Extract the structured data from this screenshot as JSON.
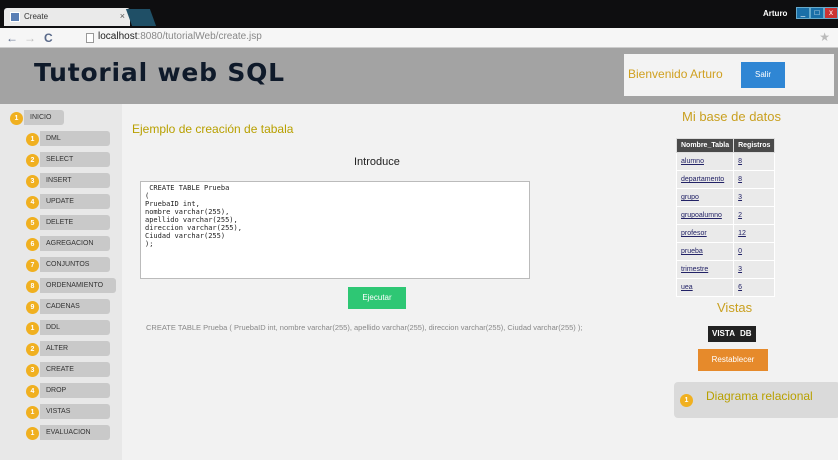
{
  "browser": {
    "tab_title": "Create",
    "tab_close": "×",
    "user": "Arturo",
    "url_host": "localhost",
    "url_rest": ":8080/tutorialWeb/create.jsp",
    "back": "←",
    "forward": "→",
    "reload": "C",
    "star": "★",
    "win_min": "_",
    "win_max": "□",
    "win_close": "x"
  },
  "header": {
    "logo": "Tutorial web SQL",
    "welcome": "Bienvenido Arturo",
    "logout": "Salir"
  },
  "sidebar": {
    "items": [
      {
        "num": "1",
        "label": "INICIO"
      },
      {
        "num": "1",
        "label": "DML"
      },
      {
        "num": "2",
        "label": "SELECT"
      },
      {
        "num": "3",
        "label": "INSERT"
      },
      {
        "num": "4",
        "label": "UPDATE"
      },
      {
        "num": "5",
        "label": "DELETE"
      },
      {
        "num": "6",
        "label": "AGREGACION"
      },
      {
        "num": "7",
        "label": "CONJUNTOS"
      },
      {
        "num": "8",
        "label": "ORDENAMIENTO"
      },
      {
        "num": "9",
        "label": "CADENAS"
      },
      {
        "num": "1",
        "label": "DDL"
      },
      {
        "num": "2",
        "label": "ALTER"
      },
      {
        "num": "3",
        "label": "CREATE"
      },
      {
        "num": "4",
        "label": "DROP"
      },
      {
        "num": "1",
        "label": "VISTAS"
      },
      {
        "num": "1",
        "label": "EVALUACION"
      }
    ]
  },
  "main": {
    "title": "Ejemplo de creación de tabala",
    "introduce": "Introduce",
    "sql": " CREATE TABLE Prueba\n(\nPruebaID int,\nnombre varchar(255),\napellido varchar(255),\ndireccion varchar(255),\nCiudad varchar(255)\n);",
    "execute": "Ejecutar",
    "result": "CREATE TABLE Prueba ( PruebaID int, nombre varchar(255), apellido varchar(255), direccion varchar(255), Ciudad varchar(255) );"
  },
  "right": {
    "db_title": "Mi base de datos",
    "table_headers": [
      "Nombre_Tabla",
      "Registros"
    ],
    "tables": [
      {
        "name": "alumno",
        "count": "8"
      },
      {
        "name": "departamento",
        "count": "8"
      },
      {
        "name": "grupo",
        "count": "3"
      },
      {
        "name": "grupoalumno",
        "count": "2"
      },
      {
        "name": "profesor",
        "count": "12"
      },
      {
        "name": "prueba",
        "count": "0"
      },
      {
        "name": "trimestre",
        "count": "3"
      },
      {
        "name": "uea",
        "count": "6"
      }
    ],
    "vistas_title": "Vistas",
    "vista_label": "VISTA",
    "db_label": "DB",
    "reset": "Restablecer",
    "diagram_num": "1",
    "diagram": "Diagrama relacional"
  }
}
